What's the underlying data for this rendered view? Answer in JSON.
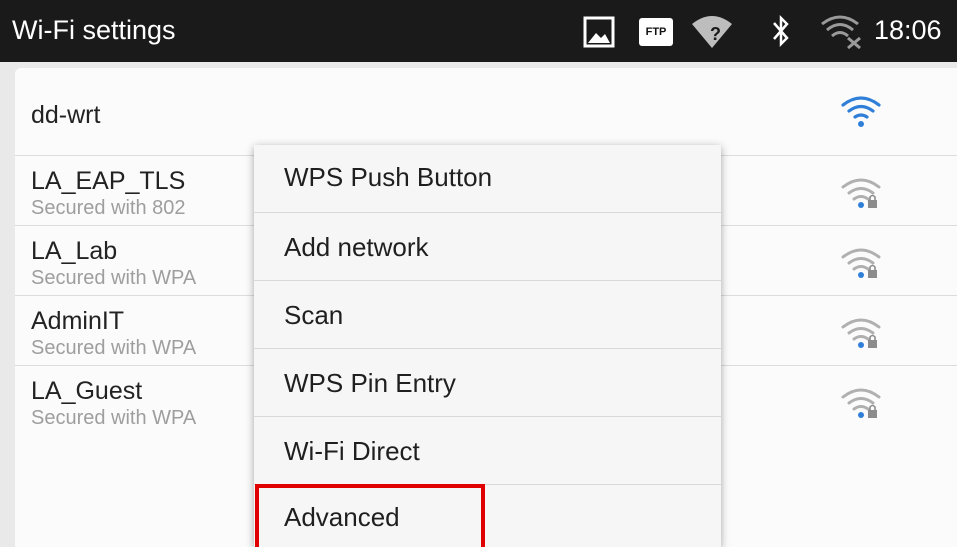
{
  "status_bar": {
    "title": "Wi-Fi settings",
    "time": "18:06",
    "icons": [
      "image-icon",
      "ftp-icon",
      "wifi-question-icon",
      "bluetooth-icon",
      "wifi-no-signal-icon"
    ],
    "ftp_label": "FTP"
  },
  "networks": [
    {
      "name": "dd-wrt",
      "subtitle": "",
      "icon": "wifi-open-icon",
      "color": "#2f7fd8"
    },
    {
      "name": "LA_EAP_TLS",
      "subtitle": "Secured with 802",
      "icon": "wifi-locked-icon",
      "color": "#b0b0b0"
    },
    {
      "name": "LA_Lab",
      "subtitle": "Secured with WPA",
      "icon": "wifi-locked-icon",
      "color": "#b0b0b0"
    },
    {
      "name": "AdminIT",
      "subtitle": "Secured with WPA",
      "icon": "wifi-locked-icon",
      "color": "#b0b0b0"
    },
    {
      "name": "LA_Guest",
      "subtitle": "Secured with WPA",
      "icon": "wifi-locked-icon",
      "color": "#b0b0b0"
    }
  ],
  "menu": {
    "items": [
      {
        "label": "WPS Push Button"
      },
      {
        "label": "Add network"
      },
      {
        "label": "Scan"
      },
      {
        "label": "WPS Pin Entry"
      },
      {
        "label": "Wi-Fi Direct"
      },
      {
        "label": "Advanced"
      }
    ],
    "highlighted": "Advanced",
    "highlight_color": "#e00000"
  }
}
